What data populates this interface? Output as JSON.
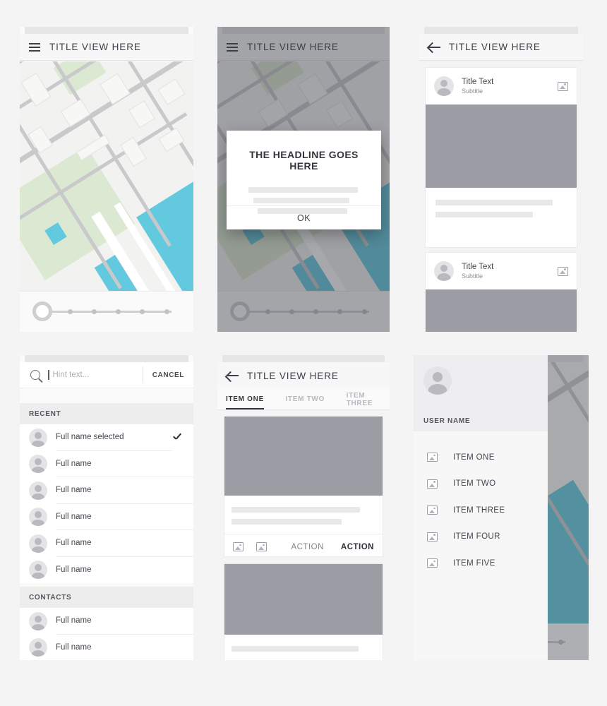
{
  "panels": {
    "map_screen": {
      "name": "map-screen",
      "appbar": {
        "nav_icon": "hamburger-icon",
        "title": "TITLE VIEW HERE"
      },
      "slider": {
        "steps": 5
      }
    },
    "dialog_screen": {
      "name": "dialog-screen",
      "appbar": {
        "nav_icon": "hamburger-icon",
        "title": "TITLE VIEW HERE"
      },
      "dialog": {
        "headline": "THE HEADLINE GOES HERE",
        "body_placeholder_lines": 3,
        "confirm_label": "OK"
      },
      "slider": {
        "steps": 5
      }
    },
    "cards_screen": {
      "name": "cards-screen",
      "appbar": {
        "nav_icon": "back-arrow-icon",
        "title": "TITLE VIEW HERE"
      },
      "cards": [
        {
          "title": "Title Text",
          "subtitle": "Subtitle",
          "action_icon": "image-icon",
          "text_lines": 2
        },
        {
          "title": "Title Text",
          "subtitle": "Subtitle",
          "action_icon": "image-icon",
          "text_lines": 0
        }
      ]
    },
    "search_screen": {
      "name": "search-screen",
      "search": {
        "placeholder": "Hint text...",
        "value": "",
        "icon": "search-icon",
        "cancel_label": "CANCEL"
      },
      "sections": [
        {
          "header": "RECENT",
          "items": [
            {
              "label": "Full name selected",
              "selected": true
            },
            {
              "label": "Full name",
              "selected": false
            },
            {
              "label": "Full name",
              "selected": false
            },
            {
              "label": "Full name",
              "selected": false
            },
            {
              "label": "Full name",
              "selected": false
            },
            {
              "label": "Full name",
              "selected": false
            }
          ]
        },
        {
          "header": "CONTACTS",
          "items": [
            {
              "label": "Full name",
              "selected": false
            },
            {
              "label": "Full name",
              "selected": false
            }
          ]
        }
      ]
    },
    "tabs_screen": {
      "name": "tabs-screen",
      "appbar": {
        "nav_icon": "back-arrow-icon",
        "title": "TITLE VIEW HERE"
      },
      "tabs": [
        {
          "label": "ITEM ONE",
          "active": true
        },
        {
          "label": "ITEM TWO",
          "active": false
        },
        {
          "label": "ITEM THREE",
          "active": false
        }
      ],
      "cards": [
        {
          "text_lines": 2,
          "icons": [
            "image-icon",
            "image-icon"
          ],
          "actions": [
            {
              "label": "ACTION",
              "emphasis": "normal"
            },
            {
              "label": "ACTION",
              "emphasis": "strong"
            }
          ]
        },
        {
          "text_lines": 1,
          "icons": [],
          "actions": []
        }
      ]
    },
    "drawer_screen": {
      "name": "drawer-screen",
      "drawer": {
        "avatar": "avatar-icon",
        "user_name": "USER NAME",
        "items": [
          {
            "label": "ITEM ONE",
            "icon": "image-icon"
          },
          {
            "label": "ITEM TWO",
            "icon": "image-icon"
          },
          {
            "label": "ITEM THREE",
            "icon": "image-icon"
          },
          {
            "label": "ITEM FOUR",
            "icon": "image-icon"
          },
          {
            "label": "ITEM FIVE",
            "icon": "image-icon"
          }
        ]
      }
    }
  },
  "colors": {
    "background": "#f4f4f5",
    "surface": "#ffffff",
    "appbar": "#f7f7f8",
    "status_bar": "#e6e6e8",
    "media_placeholder": "#9c9ca4",
    "text_placeholder": "#e8e8ea",
    "water": "#63c9de",
    "park": "#dbe8d2",
    "road": "#c9c9cb",
    "primary_text": "#34363d",
    "secondary_text": "#8b8d95",
    "scrim": "rgba(60,62,70,0.45)"
  }
}
